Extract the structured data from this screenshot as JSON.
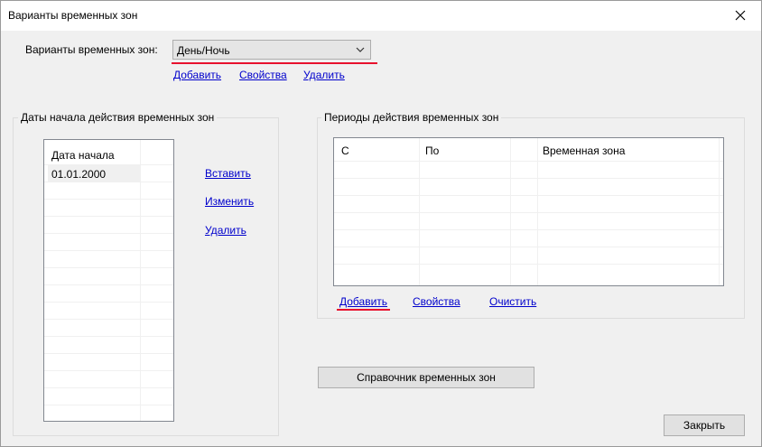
{
  "window": {
    "title": "Варианты временных зон"
  },
  "variants": {
    "label": "Варианты временных зон:",
    "selected": "День/Ночь",
    "add": "Добавить",
    "props": "Свойства",
    "delete": "Удалить"
  },
  "dates": {
    "group_title": "Даты начала действия временных зон",
    "column": "Дата начала",
    "rows": [
      "01.01.2000"
    ],
    "insert": "Вставить",
    "edit": "Изменить",
    "delete": "Удалить"
  },
  "periods": {
    "group_title": "Периоды действия временных зон",
    "columns": [
      "С",
      "По",
      "",
      "Временная зона"
    ],
    "add": "Добавить",
    "props": "Свойства",
    "clear": "Очистить"
  },
  "buttons": {
    "directory": "Справочник временных зон",
    "close": "Закрыть"
  },
  "colors": {
    "highlight_underline": "#e8112d",
    "link": "#0000cc"
  }
}
